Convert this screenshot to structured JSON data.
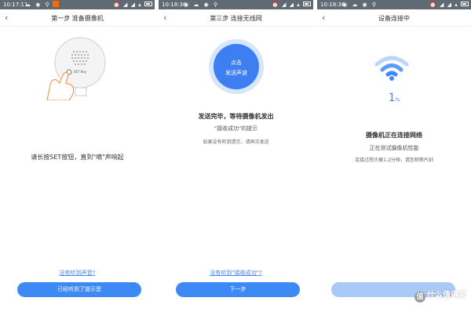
{
  "panels": [
    {
      "status_time": "10:17:11",
      "nav_title": "第一步 准备摄像机",
      "camera_label": "SET Key",
      "instruction": "请长按SET按钮，直到\"嘀\"声响起",
      "link": "没有听到声音?",
      "button": "已经听到了提示音"
    },
    {
      "status_time": "10:18:30",
      "nav_title": "第三步 连接无线网",
      "circle_line1": "点击",
      "circle_line2": "发送声波",
      "heading": "发送完毕，等待摄像机发出",
      "subheading": "\"接收成功\"的提示",
      "hint": "如果没有听到提示，请再次发送",
      "link": "没有听到\"接收成功\"?",
      "button": "下一步"
    },
    {
      "status_time": "10:18:36",
      "nav_title": "设备连接中",
      "progress_value": "1",
      "progress_unit": "%",
      "heading": "摄像机正在连接网络",
      "subheading": "正在测试摄像机性能",
      "hint": "连接过程大概1-2分钟，请您稍等片刻",
      "button": ""
    }
  ],
  "watermark": "什么值得买",
  "colors": {
    "statusbar": "#5f6a73",
    "accent": "#3d8af7",
    "accent_disabled": "#a9c9f6",
    "link": "#4a86e8"
  }
}
